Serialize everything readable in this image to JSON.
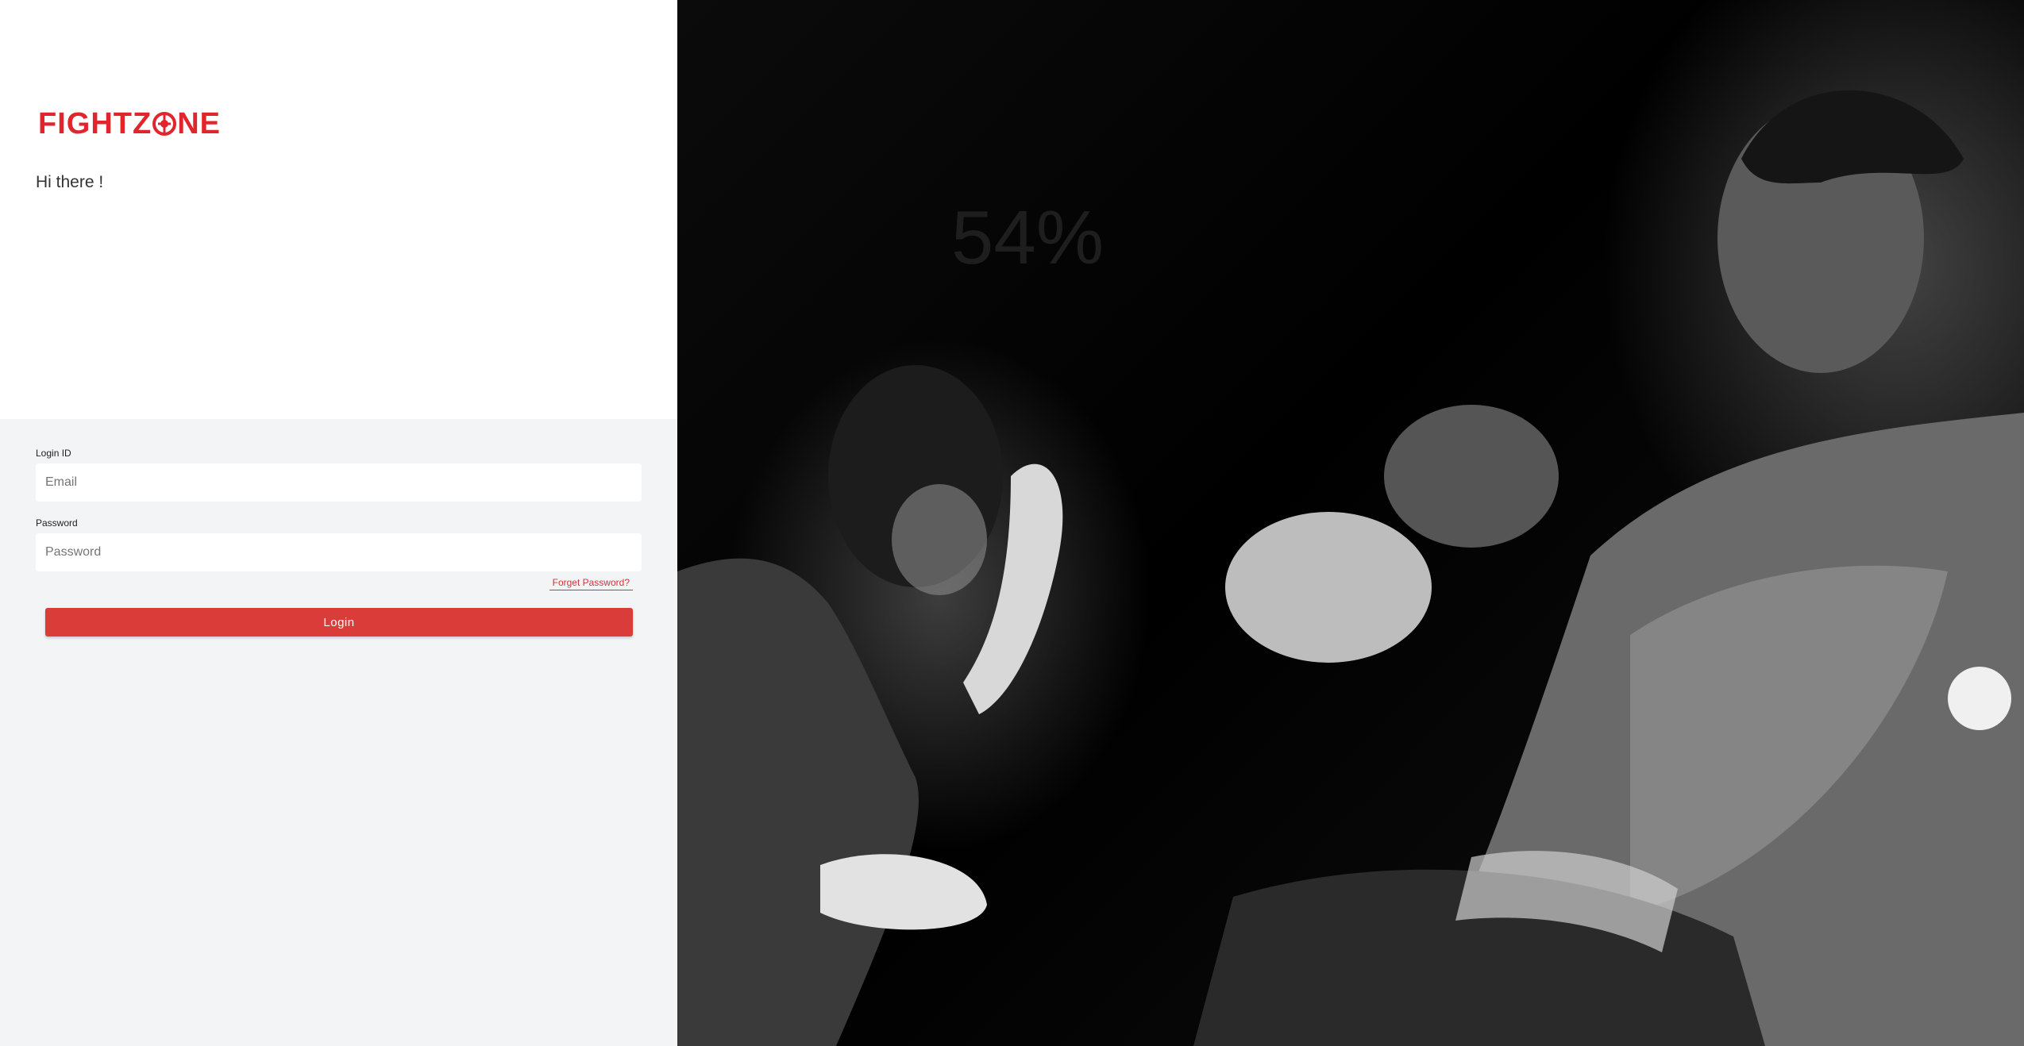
{
  "brand": {
    "name_part1": "FIGHTZ",
    "name_part2": "NE",
    "logo_icon": "boxing-o-icon",
    "color": "#e0262c"
  },
  "greeting": "Hi there !",
  "form": {
    "login_label": "Login ID",
    "email_placeholder": "Email",
    "email_value": "",
    "password_label": "Password",
    "password_placeholder": "Password",
    "password_value": "",
    "forgot_link": "Forget Password?",
    "login_button": "Login",
    "accent_color": "#da3d39"
  },
  "hero_image": {
    "subject": "two kickboxers training with pads (black and white photo)",
    "background_text": "54%"
  }
}
